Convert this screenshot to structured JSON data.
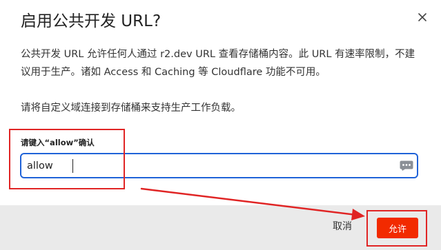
{
  "dialog": {
    "title": "启用公共开发 URL?",
    "body_paragraph_1": "公共开发 URL 允许任何人通过 r2.dev URL 查看存储桶内容。此 URL 有速率限制，不建议用于生产。诸如 Access 和 Caching 等 Cloudflare 功能不可用。",
    "body_paragraph_2": "请将自定义域连接到存储桶来支持生产工作负载。",
    "confirm_label": "请键入“allow”确认",
    "confirm_input_value": "allow",
    "cancel_label": "取消",
    "allow_label": "允许"
  },
  "icons": {
    "close": "close-icon",
    "password_manager": "password-manager-icon"
  },
  "colors": {
    "input_focus_border": "#1f62d8",
    "primary_button": "#f22a00",
    "footer_background": "#eaeaea",
    "annotation_red": "#e02424"
  }
}
